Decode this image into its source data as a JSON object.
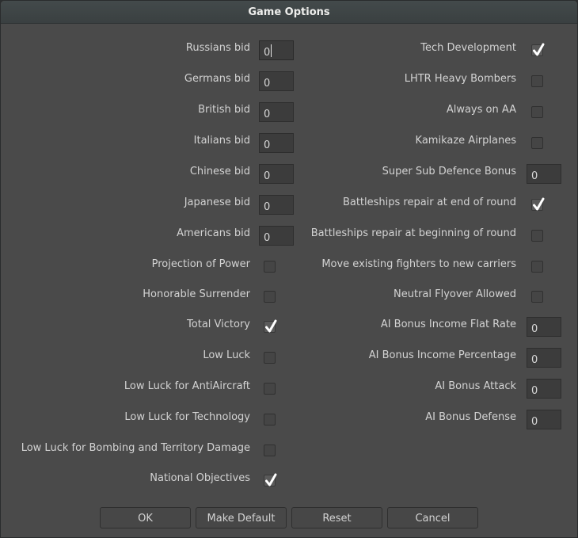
{
  "window": {
    "title": "Game Options"
  },
  "left_column": [
    {
      "label": "Russians bid",
      "type": "number",
      "value": "0",
      "focused": true
    },
    {
      "label": "Germans bid",
      "type": "number",
      "value": "0"
    },
    {
      "label": "British bid",
      "type": "number",
      "value": "0"
    },
    {
      "label": "Italians bid",
      "type": "number",
      "value": "0"
    },
    {
      "label": "Chinese bid",
      "type": "number",
      "value": "0"
    },
    {
      "label": "Japanese bid",
      "type": "number",
      "value": "0"
    },
    {
      "label": "Americans bid",
      "type": "number",
      "value": "0"
    },
    {
      "label": "Projection of Power",
      "type": "checkbox",
      "checked": false
    },
    {
      "label": "Honorable Surrender",
      "type": "checkbox",
      "checked": false
    },
    {
      "label": "Total Victory",
      "type": "checkbox",
      "checked": true
    },
    {
      "label": "Low Luck",
      "type": "checkbox",
      "checked": false
    },
    {
      "label": "Low Luck for AntiAircraft",
      "type": "checkbox",
      "checked": false
    },
    {
      "label": "Low Luck for Technology",
      "type": "checkbox",
      "checked": false
    },
    {
      "label": "Low Luck for Bombing and Territory Damage",
      "type": "checkbox",
      "checked": false
    },
    {
      "label": "National Objectives",
      "type": "checkbox",
      "checked": true
    }
  ],
  "right_column": [
    {
      "label": "Tech Development",
      "type": "checkbox",
      "checked": true
    },
    {
      "label": "LHTR Heavy Bombers",
      "type": "checkbox",
      "checked": false
    },
    {
      "label": "Always on AA",
      "type": "checkbox",
      "checked": false
    },
    {
      "label": "Kamikaze Airplanes",
      "type": "checkbox",
      "checked": false
    },
    {
      "label": "Super Sub Defence Bonus",
      "type": "number",
      "value": "0"
    },
    {
      "label": "Battleships repair at end of round",
      "type": "checkbox",
      "checked": true
    },
    {
      "label": "Battleships repair at beginning of round",
      "type": "checkbox",
      "checked": false
    },
    {
      "label": "Move existing fighters to new carriers",
      "type": "checkbox",
      "checked": false
    },
    {
      "label": "Neutral Flyover Allowed",
      "type": "checkbox",
      "checked": false
    },
    {
      "label": "AI Bonus Income Flat Rate",
      "type": "number",
      "value": "0"
    },
    {
      "label": "AI Bonus Income Percentage",
      "type": "number",
      "value": "0"
    },
    {
      "label": "AI Bonus Attack",
      "type": "number",
      "value": "0"
    },
    {
      "label": "AI Bonus Defense",
      "type": "number",
      "value": "0"
    }
  ],
  "buttons": {
    "ok": "OK",
    "make_default": "Make Default",
    "reset": "Reset",
    "cancel": "Cancel"
  },
  "icons": {
    "checkmark": "check-icon"
  }
}
